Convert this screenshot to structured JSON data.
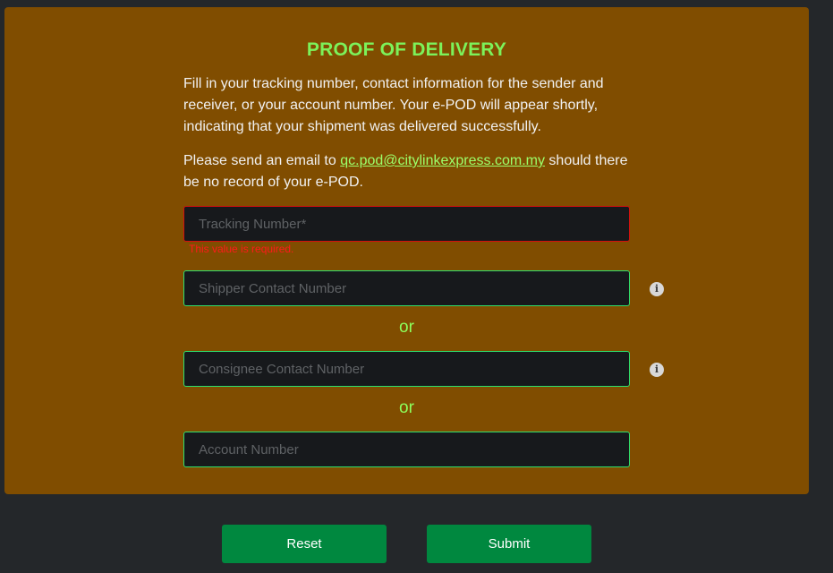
{
  "form": {
    "title": "PROOF OF DELIVERY",
    "intro": "Fill in your tracking number, contact information for the sender and receiver, or your account number. Your e-POD will appear shortly, indicating that your shipment was delivered successfully.",
    "note_prefix": "Please send an email to ",
    "email": "qc.pod@citylinkexpress.com.my",
    "note_suffix": " should there be no record of your e-POD.",
    "fields": {
      "tracking_placeholder": "Tracking Number*",
      "tracking_error": "This value is required.",
      "shipper_placeholder": "Shipper Contact Number",
      "consignee_placeholder": "Consignee Contact Number",
      "account_placeholder": "Account Number"
    },
    "or_label": "or"
  },
  "buttons": {
    "reset_label": "Reset",
    "submit_label": "Submit"
  },
  "colors": {
    "panel_bg": "#804d00",
    "title_color": "#7cf25a",
    "field_border": "#2ee06d",
    "error_color": "#ff1a1a",
    "button_bg": "#00883f",
    "page_bg": "#24272a"
  },
  "icons": {
    "info": "info-icon"
  }
}
